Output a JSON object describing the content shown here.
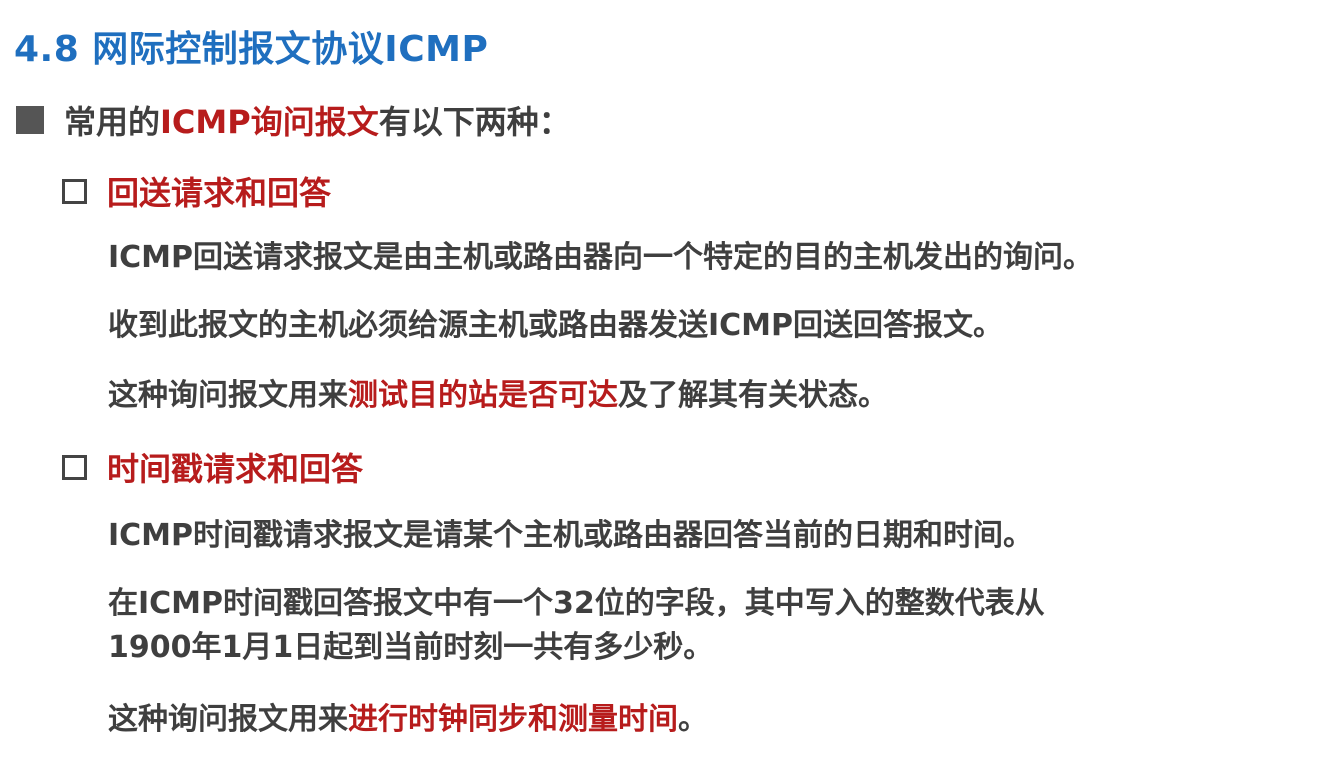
{
  "slide": {
    "title": "4.8 网际控制报文协议ICMP",
    "level1": {
      "pre": "常用的",
      "emph": "ICMP询问报文",
      "post": "有以下两种："
    },
    "items": [
      {
        "heading": "回送请求和回答",
        "lines": [
          {
            "text": "ICMP回送请求报文是由主机或路由器向一个特定的目的主机发出的询问。"
          },
          {
            "text": "收到此报文的主机必须给源主机或路由器发送ICMP回送回答报文。"
          },
          {
            "pre": "这种询问报文用来",
            "emph": "测试目的站是否可达",
            "post": "及了解其有关状态。"
          }
        ]
      },
      {
        "heading": "时间戳请求和回答",
        "lines": [
          {
            "text": "ICMP时间戳请求报文是请某个主机或路由器回答当前的日期和时间。"
          },
          {
            "text": "在ICMP时间戳回答报文中有一个32位的字段，其中写入的整数代表从"
          },
          {
            "text": "1900年1月1日起到当前时刻一共有多少秒。"
          },
          {
            "pre": "这种询问报文用来",
            "emph": "进行时钟同步和测量时间",
            "post": "。"
          }
        ]
      }
    ]
  },
  "colors": {
    "title": "#1f6fbf",
    "text": "#3f3f3f",
    "emphasis": "#b71c1c"
  }
}
